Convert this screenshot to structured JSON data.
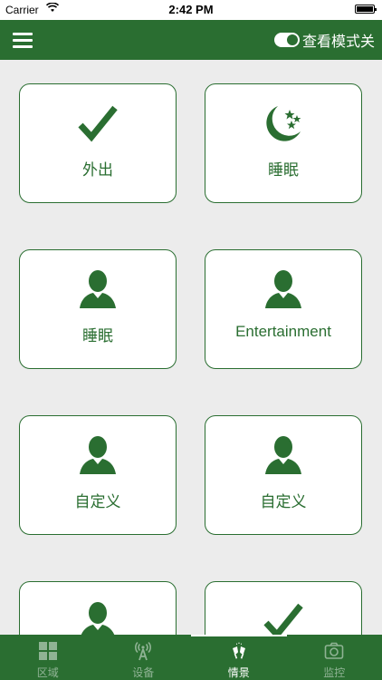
{
  "status_bar": {
    "carrier": "Carrier",
    "time": "2:42 PM"
  },
  "header": {
    "view_mode_label": "查看模式关"
  },
  "scenes": [
    {
      "label": "外出",
      "icon": "checkmark-icon"
    },
    {
      "label": "睡眠",
      "icon": "moon-stars-icon"
    },
    {
      "label": "睡眠",
      "icon": "person-icon"
    },
    {
      "label": "Entertainment",
      "icon": "person-icon"
    },
    {
      "label": "自定义",
      "icon": "person-icon"
    },
    {
      "label": "自定义",
      "icon": "person-icon"
    },
    {
      "label": "",
      "icon": "person-icon"
    },
    {
      "label": "",
      "icon": "checkmark-icon"
    }
  ],
  "tabs": [
    {
      "label": "区域",
      "icon": "grid-icon",
      "active": false
    },
    {
      "label": "设备",
      "icon": "antenna-icon",
      "active": false
    },
    {
      "label": "情景",
      "icon": "cheers-icon",
      "active": true
    },
    {
      "label": "监控",
      "icon": "camera-icon",
      "active": false
    }
  ],
  "colors": {
    "primary": "#2a6e31",
    "background": "#ececec",
    "card": "#ffffff",
    "tab_inactive": "#8fb394"
  }
}
